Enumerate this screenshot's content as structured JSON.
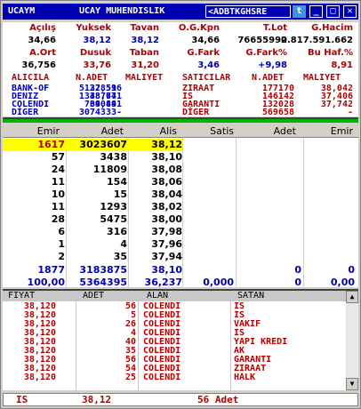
{
  "title": {
    "symbol": "UCAYM",
    "company": "UCAY MUHENDISLIK",
    "ticker": "<ADBTKGHSRE"
  },
  "summary": {
    "headers1": [
      "Açılış",
      "Yuksek",
      "Tavan",
      "O.G.Kpn",
      "T.Lot",
      "G.Hacim"
    ],
    "values1": [
      "34,66",
      "38,12",
      "38,12",
      "34,66",
      "76655990",
      "2.817.591.662"
    ],
    "headers2": [
      "A.Ort",
      "Dusuk",
      "Taban",
      "G.Fark",
      "G.Fark%",
      "Bu Haf.%"
    ],
    "values2": [
      "36,756",
      "33,76",
      "31,20",
      "3,46",
      "+9,98",
      "8,91"
    ]
  },
  "depth": {
    "headers": [
      "ALICILA",
      "N.ADET",
      "MALIYET",
      "SATICILAR",
      "N.ADET",
      "MALIYET"
    ],
    "rows": [
      [
        "BANK-OF",
        "5122851",
        "37,596",
        "ZIRAAT",
        "177170",
        "38,042"
      ],
      [
        "DENIZ",
        "1348777",
        "38,641",
        "IS",
        "146142",
        "37,406"
      ],
      [
        "COLENDI",
        "704044",
        "39,891",
        "GARANTI",
        "132028",
        "37,742"
      ],
      [
        "DİGER",
        "3074333",
        "-",
        "DİGER",
        "569658",
        "-"
      ]
    ]
  },
  "book": {
    "headers": [
      "Emir",
      "Adet",
      "Alis",
      "Satis",
      "Adet",
      "Emir"
    ],
    "rows": [
      [
        "1617",
        "3023607",
        "38,12",
        "",
        "",
        ""
      ],
      [
        "57",
        "3438",
        "38,10",
        "",
        "",
        ""
      ],
      [
        "24",
        "11809",
        "38,08",
        "",
        "",
        ""
      ],
      [
        "11",
        "154",
        "38,06",
        "",
        "",
        ""
      ],
      [
        "10",
        "15",
        "38,04",
        "",
        "",
        ""
      ],
      [
        "11",
        "1293",
        "38,02",
        "",
        "",
        ""
      ],
      [
        "28",
        "5475",
        "38,00",
        "",
        "",
        ""
      ],
      [
        "6",
        "316",
        "37,98",
        "",
        "",
        ""
      ],
      [
        "1",
        "4",
        "37,96",
        "",
        "",
        ""
      ],
      [
        "2",
        "35",
        "37,94",
        "",
        "",
        ""
      ]
    ],
    "totals1": [
      "1877",
      "3183875",
      "38,10",
      "",
      "0",
      "0"
    ],
    "totals2": [
      "100,00",
      "5364395",
      "36,237",
      "0,000",
      "0",
      "0,00"
    ]
  },
  "trades": {
    "headers": [
      "FIYAT",
      "ADET",
      "ALAN",
      "SATAN"
    ],
    "rows": [
      [
        "38,120",
        "56",
        "COLENDI",
        "IS"
      ],
      [
        "38,120",
        "5",
        "COLENDI",
        "IS"
      ],
      [
        "38,120",
        "26",
        "COLENDI",
        "VAKIF"
      ],
      [
        "38,120",
        "4",
        "COLENDI",
        "IS"
      ],
      [
        "38,120",
        "40",
        "COLENDI",
        "YAPI KREDI"
      ],
      [
        "38,120",
        "35",
        "COLENDI",
        "AK"
      ],
      [
        "38,120",
        "56",
        "COLENDI",
        "GARANTI"
      ],
      [
        "38,120",
        "54",
        "COLENDI",
        "ZIRAAT"
      ],
      [
        "38,120",
        "25",
        "COLENDI",
        "HALK"
      ]
    ]
  },
  "status": {
    "broker": "IS",
    "price": "38,12",
    "qty": "56 Adet"
  },
  "colors": {
    "title_bg": "#0000b4",
    "header_red": "#b00000",
    "buy_blue": "#0000b4",
    "highlight": "#ffff00",
    "green_bar": "#00b400"
  }
}
